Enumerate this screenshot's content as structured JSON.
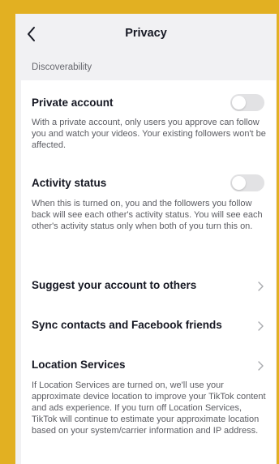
{
  "header": {
    "title": "Privacy",
    "back_icon": "chevron-left-icon"
  },
  "section": {
    "label": "Discoverability"
  },
  "private_account": {
    "title": "Private account",
    "enabled": false,
    "description": "With a private account, only users you approve can follow you and watch your videos. Your existing followers won't be affected."
  },
  "activity_status": {
    "title": "Activity status",
    "enabled": false,
    "description": "When this is turned on, you and the followers you follow back will see each other's activity status. You will see each other's activity status only when both of you turn this on."
  },
  "suggest_account": {
    "title": "Suggest your account to others"
  },
  "sync_contacts": {
    "title": "Sync contacts and Facebook friends"
  },
  "location_services": {
    "title": "Location Services",
    "description": "If Location Services are turned on, we'll use your approximate device location to improve your TikTok content and ads experience. If you turn off Location Services, TikTok will continue to estimate your approximate location based on your system/carrier information and IP address."
  },
  "colors": {
    "frame": "#e2b022",
    "background": "#f1f1f3",
    "card": "#ffffff",
    "toggle_off": "#e2e2e4",
    "text_primary": "#161823",
    "text_secondary": "#5c5d63"
  }
}
